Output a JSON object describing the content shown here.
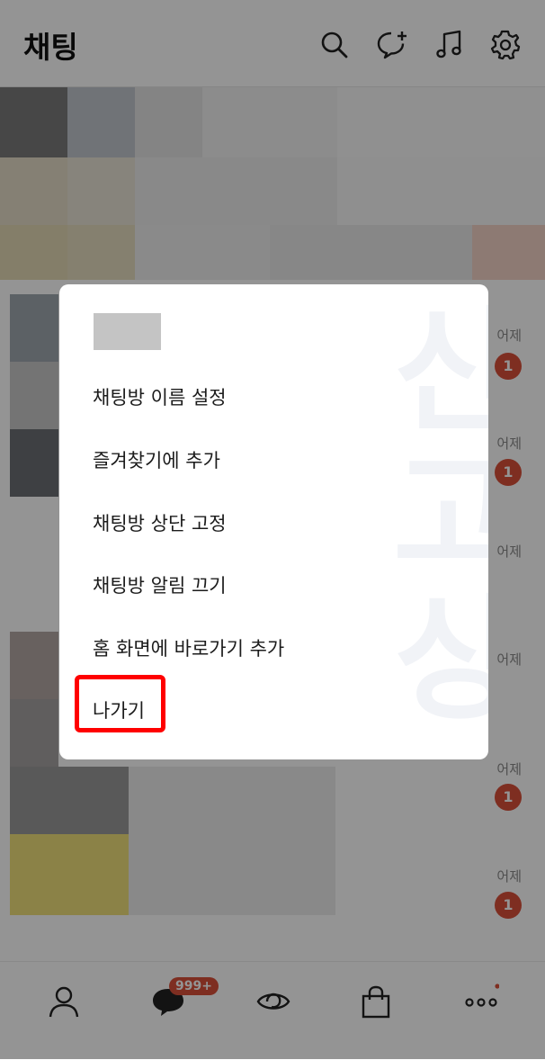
{
  "header": {
    "title": "채팅",
    "icons": [
      "search-icon",
      "new-chat-icon",
      "music-icon",
      "settings-icon"
    ]
  },
  "chat_list": {
    "items": [
      {
        "time": "어제",
        "unread": "1"
      },
      {
        "time": "어제",
        "unread": "1"
      },
      {
        "time": "어제",
        "unread": ""
      },
      {
        "time": "어제",
        "unread": ""
      },
      {
        "time": "어제",
        "unread": "1"
      },
      {
        "time": "어제",
        "unread": "1"
      }
    ]
  },
  "context_menu": {
    "items": [
      "채팅방 이름 설정",
      "즐겨찾기에 추가",
      "채팅방 상단 고정",
      "채팅방 알림 끄기",
      "홈 화면에 바로가기 추가",
      "나가기"
    ],
    "highlighted_item": "나가기"
  },
  "bottom_nav": {
    "chat_badge": "999+",
    "icons": [
      "friends-icon",
      "chat-icon",
      "view-icon",
      "shopping-icon",
      "more-icon"
    ]
  },
  "colors": {
    "badge": "#d9503a",
    "highlight_border": "#ff0000",
    "overlay": "rgba(0,0,0,0.42)"
  }
}
